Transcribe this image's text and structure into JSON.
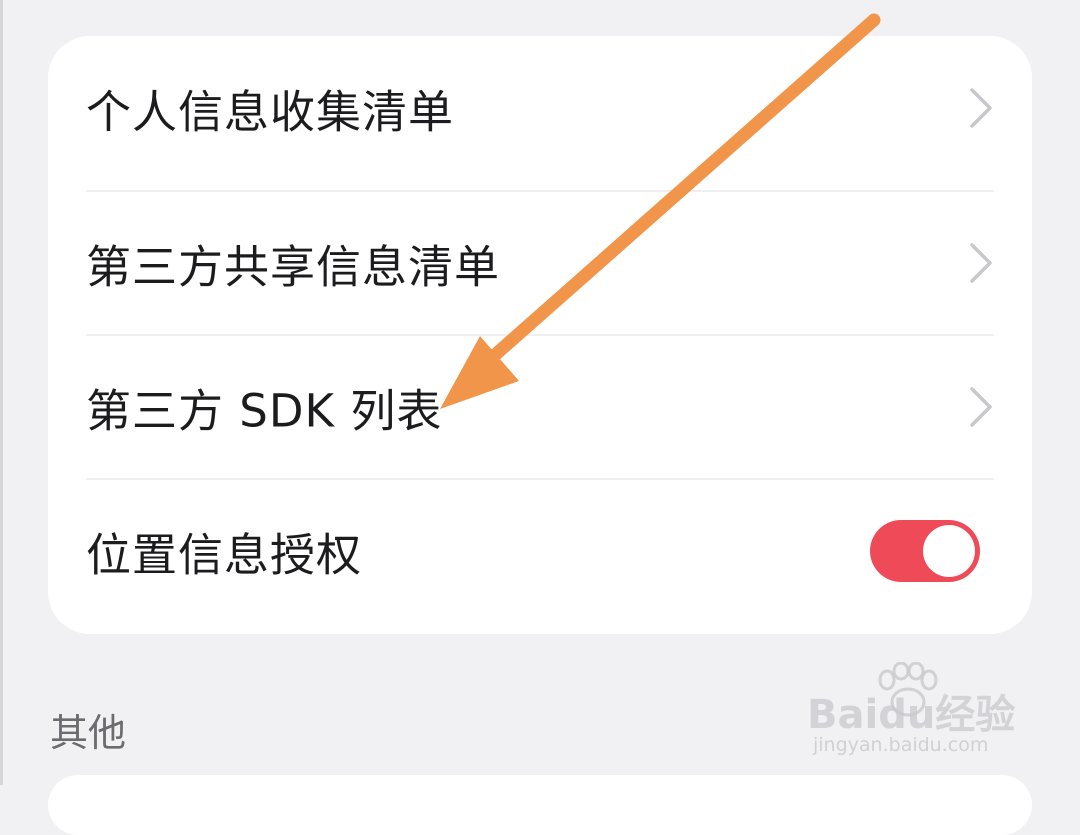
{
  "settings_list": {
    "items": [
      {
        "label": "个人信息收集清单",
        "type": "link",
        "icon": "chevron-right-icon"
      },
      {
        "label": "第三方共享信息清单",
        "type": "link",
        "icon": "chevron-right-icon"
      },
      {
        "label": "第三方 SDK 列表",
        "type": "link",
        "icon": "chevron-right-icon"
      },
      {
        "label": "位置信息授权",
        "type": "toggle",
        "value": true
      }
    ]
  },
  "other_section": {
    "header": "其他"
  },
  "watermark": {
    "logo": "Baidu经验",
    "url": "jingyan.baidu.com"
  },
  "annotation": {
    "icon": "orange-arrow-icon",
    "color": "#f0954a",
    "points_to": "第三方 SDK 列表"
  },
  "colors": {
    "background": "#f1f1f3",
    "card": "#ffffff",
    "toggle_on": "#ef4a57",
    "chevron": "#c7c7cc"
  }
}
